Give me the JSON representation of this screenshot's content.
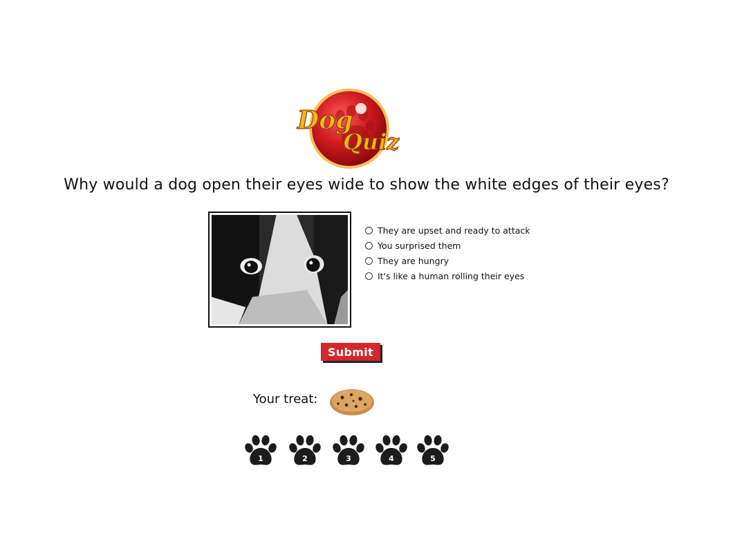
{
  "logo": {
    "line1": "Dog",
    "line2": "Quiz"
  },
  "question": "Why would a dog open their eyes wide to show the white edges of their eyes?",
  "options": [
    "They are upset and ready to attack",
    "You surprised them",
    "They are hungry",
    "It's like a human rolling their eyes"
  ],
  "submit_label": "Submit",
  "treat_label": "Your treat:",
  "paws": [
    "1",
    "2",
    "3",
    "4",
    "5"
  ],
  "colors": {
    "submit_bg": "#d4262b",
    "logo_red": "#c8141c",
    "logo_gold": "#f2b51e",
    "paw": "#1c1c1c"
  }
}
